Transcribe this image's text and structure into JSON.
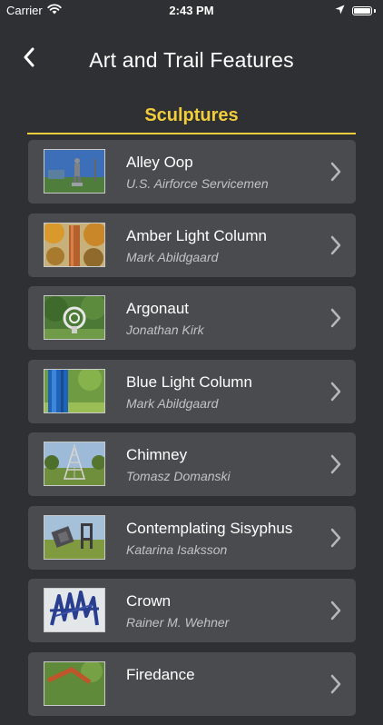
{
  "status_bar": {
    "carrier": "Carrier",
    "time": "2:43 PM",
    "battery_level": 1.0
  },
  "nav": {
    "title": "Art and Trail Features"
  },
  "section": {
    "title": "Sculptures",
    "accent_color": "#f2cd3b"
  },
  "items": [
    {
      "title": "Alley Oop",
      "subtitle": "U.S. Airforce Servicemen"
    },
    {
      "title": "Amber Light Column",
      "subtitle": "Mark Abildgaard"
    },
    {
      "title": "Argonaut",
      "subtitle": "Jonathan Kirk"
    },
    {
      "title": "Blue Light Column",
      "subtitle": "Mark Abildgaard"
    },
    {
      "title": "Chimney",
      "subtitle": "Tomasz Domanski"
    },
    {
      "title": "Contemplating Sisyphus",
      "subtitle": "Katarina Isaksson"
    },
    {
      "title": "Crown",
      "subtitle": "Rainer M. Wehner"
    },
    {
      "title": "Firedance",
      "subtitle": ""
    }
  ]
}
